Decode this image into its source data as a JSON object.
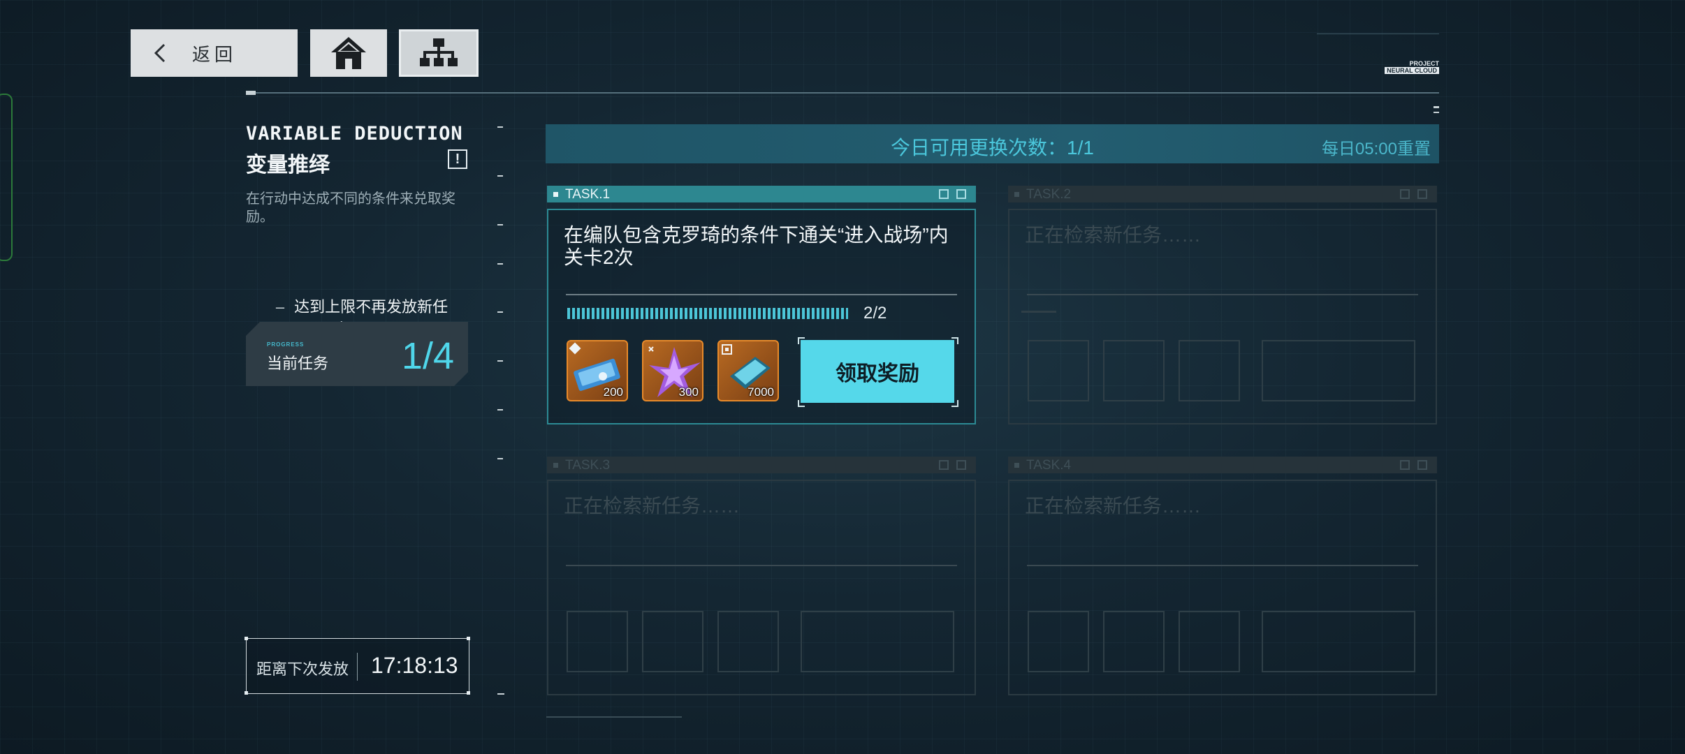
{
  "nav": {
    "back_label": "返回",
    "home_icon": "home-icon",
    "tree_icon": "hierarchy-icon"
  },
  "logo": {
    "line1": "PROJECT",
    "line2": "NEURAL CLOUD"
  },
  "panel": {
    "title_en": "VARIABLE DEDUCTION",
    "title_zh": "变量推绎",
    "info_icon": "!",
    "description": "在行动中达成不同的条件来兑取奖励。",
    "limit_text": "达到上限不再发放新任务",
    "progress_label": "PROGRESS",
    "current_task_label": "当前任务",
    "current_task_count": "1/4",
    "countdown_label": "距离下次发放",
    "countdown_time": "17:18:13"
  },
  "banner": {
    "swap_text": "今日可用更换次数：1/1",
    "reset_text": "每日05:00重置"
  },
  "tasks": [
    {
      "header": "TASK.1",
      "description": "在编队包含克罗琦的条件下通关“进入战场”内关卡2次",
      "progress_text": "2/2",
      "progress": 1.0,
      "rewards": [
        {
          "icon": "ticket-card-icon",
          "qty": "200"
        },
        {
          "icon": "purple-crystal-icon",
          "qty": "300"
        },
        {
          "icon": "data-chip-icon",
          "qty": "7000"
        }
      ],
      "claim_label": "领取奖励"
    },
    {
      "header": "TASK.2",
      "description": "正在检索新任务……"
    },
    {
      "header": "TASK.3",
      "description": "正在检索新任务……"
    },
    {
      "header": "TASK.4",
      "description": "正在检索新任务……"
    }
  ]
}
